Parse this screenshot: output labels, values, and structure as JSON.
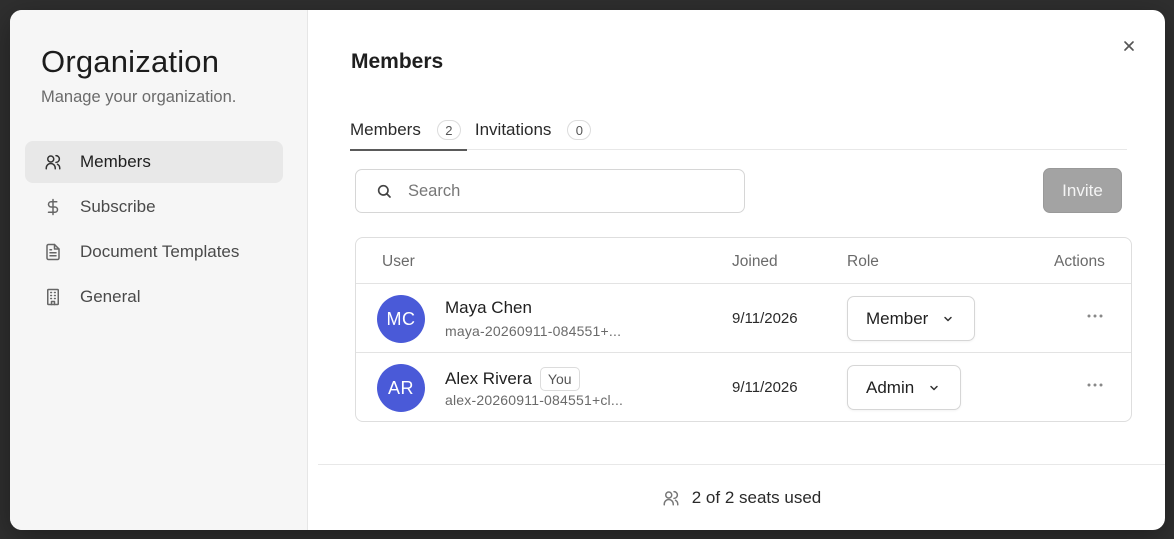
{
  "sidebar": {
    "title": "Organization",
    "subtitle": "Manage your organization.",
    "items": [
      {
        "label": "Members",
        "icon": "users-icon",
        "active": true
      },
      {
        "label": "Subscribe",
        "icon": "dollar-icon",
        "active": false
      },
      {
        "label": "Document Templates",
        "icon": "document-icon",
        "active": false
      },
      {
        "label": "General",
        "icon": "building-icon",
        "active": false
      }
    ]
  },
  "main": {
    "title": "Members",
    "tabs": [
      {
        "label": "Members",
        "count": "2",
        "active": true
      },
      {
        "label": "Invitations",
        "count": "0",
        "active": false
      }
    ],
    "search": {
      "placeholder": "Search",
      "value": ""
    },
    "invite_label": "Invite",
    "table": {
      "headers": {
        "user": "User",
        "joined": "Joined",
        "role": "Role",
        "actions": "Actions"
      },
      "rows": [
        {
          "initials": "MC",
          "name": "Maya Chen",
          "you": "",
          "email": "maya-20260911-084551+...",
          "joined": "9/11/2026",
          "role": "Member"
        },
        {
          "initials": "AR",
          "name": "Alex Rivera",
          "you": "You",
          "email": "alex-20260911-084551+cl...",
          "joined": "9/11/2026",
          "role": "Admin"
        }
      ]
    },
    "footer": {
      "seats_text": "2 of 2 seats used"
    }
  },
  "colors": {
    "avatar": "#4a5ad8",
    "invite_disabled": "#a3a3a3",
    "sidebar_bg": "#f6f6f6"
  }
}
